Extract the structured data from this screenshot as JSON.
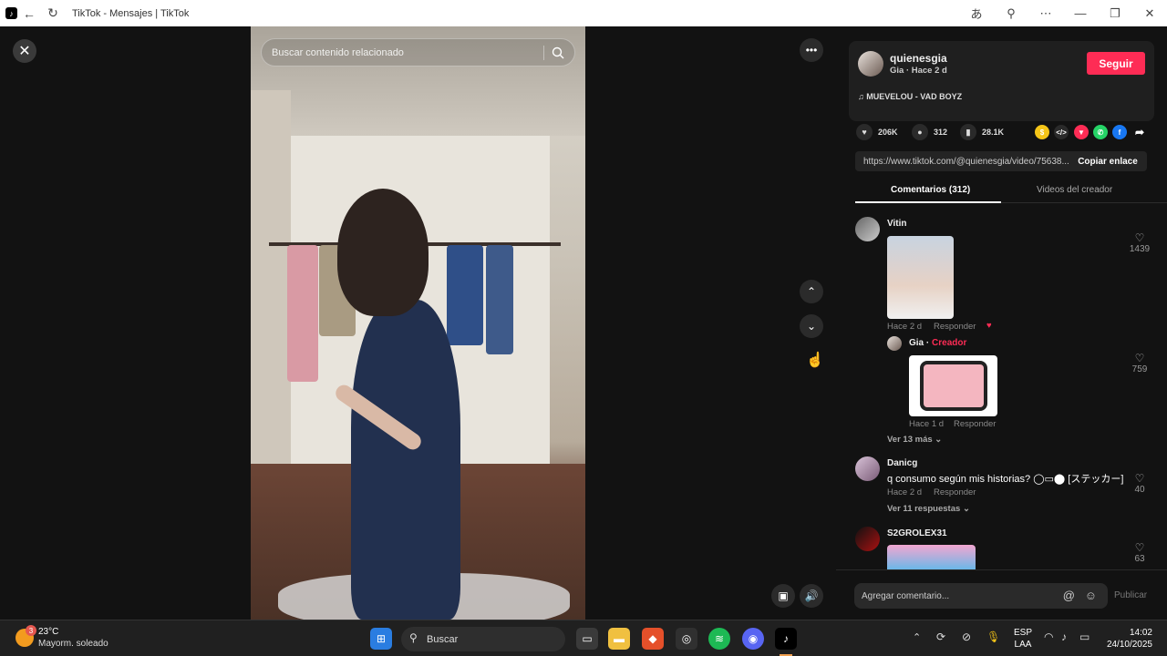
{
  "window": {
    "title": "TikTok - Mensajes | TikTok",
    "icons": [
      "tiktok-icon",
      "back-icon",
      "refresh-icon",
      "read-aloud-icon",
      "zoom-icon",
      "more-icon",
      "minimize-icon",
      "restore-icon",
      "close-icon"
    ]
  },
  "player": {
    "search_placeholder": "Buscar contenido relacionado"
  },
  "post": {
    "username": "quienesgia",
    "subline": "Gia · Hace 2 d",
    "follow_label": "Seguir",
    "music": "MUEVELOU - VAD BOYZ",
    "likes": "206K",
    "comments": "312",
    "saves": "28.1K",
    "link": "https://www.tiktok.com/@quienesgia/video/75638...",
    "copy_label": "Copiar enlace",
    "share_colors": {
      "coin": "#f5c518",
      "embed": "#2a2a2a",
      "friends": "#fe2c55",
      "whatsapp": "#25d366",
      "facebook": "#1877f2"
    }
  },
  "tabs": {
    "comments": "Comentarios (312)",
    "creator_videos": "Videos del creador"
  },
  "comments": [
    {
      "user": "Vitin",
      "time": "Hace 2 d",
      "reply": "Responder",
      "likes": "1439"
    },
    {
      "user": "Gia",
      "creator_tag": "Creador",
      "time": "Hace 1 d",
      "reply": "Responder",
      "likes": "759"
    },
    {
      "more": "Ver 13 más"
    },
    {
      "user": "Danicg",
      "text": "q consumo según mis historias? ◯▭⬤ [ステッカー]",
      "time": "Hace 2 d",
      "reply": "Responder",
      "likes": "40",
      "replies": "Ver 11 respuestas"
    },
    {
      "user": "S2GROLEX31",
      "likes": "63"
    }
  ],
  "footer": {
    "placeholder": "Agregar comentario...",
    "publish": "Publicar"
  },
  "taskbar": {
    "temp": "23°C",
    "weather": "Mayorm. soleado",
    "weather_badge": "3",
    "search": "Buscar",
    "lang1": "ESP",
    "lang2": "LAA",
    "time": "14:02",
    "date": "24/10/2025"
  }
}
